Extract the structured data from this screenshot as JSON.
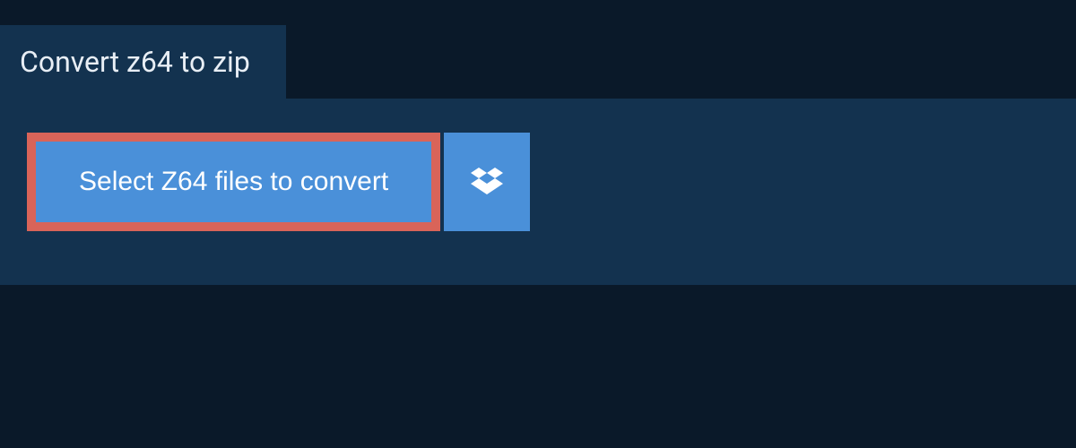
{
  "header": {
    "title": "Convert z64 to zip"
  },
  "actions": {
    "select_files_label": "Select Z64 files to convert"
  },
  "icons": {
    "dropbox": "dropbox-icon"
  },
  "colors": {
    "background": "#0a1929",
    "panel": "#13324f",
    "button": "#4a90d9",
    "highlight_border": "#d96459",
    "text_light": "#e8eef5",
    "text_white": "#ffffff"
  }
}
